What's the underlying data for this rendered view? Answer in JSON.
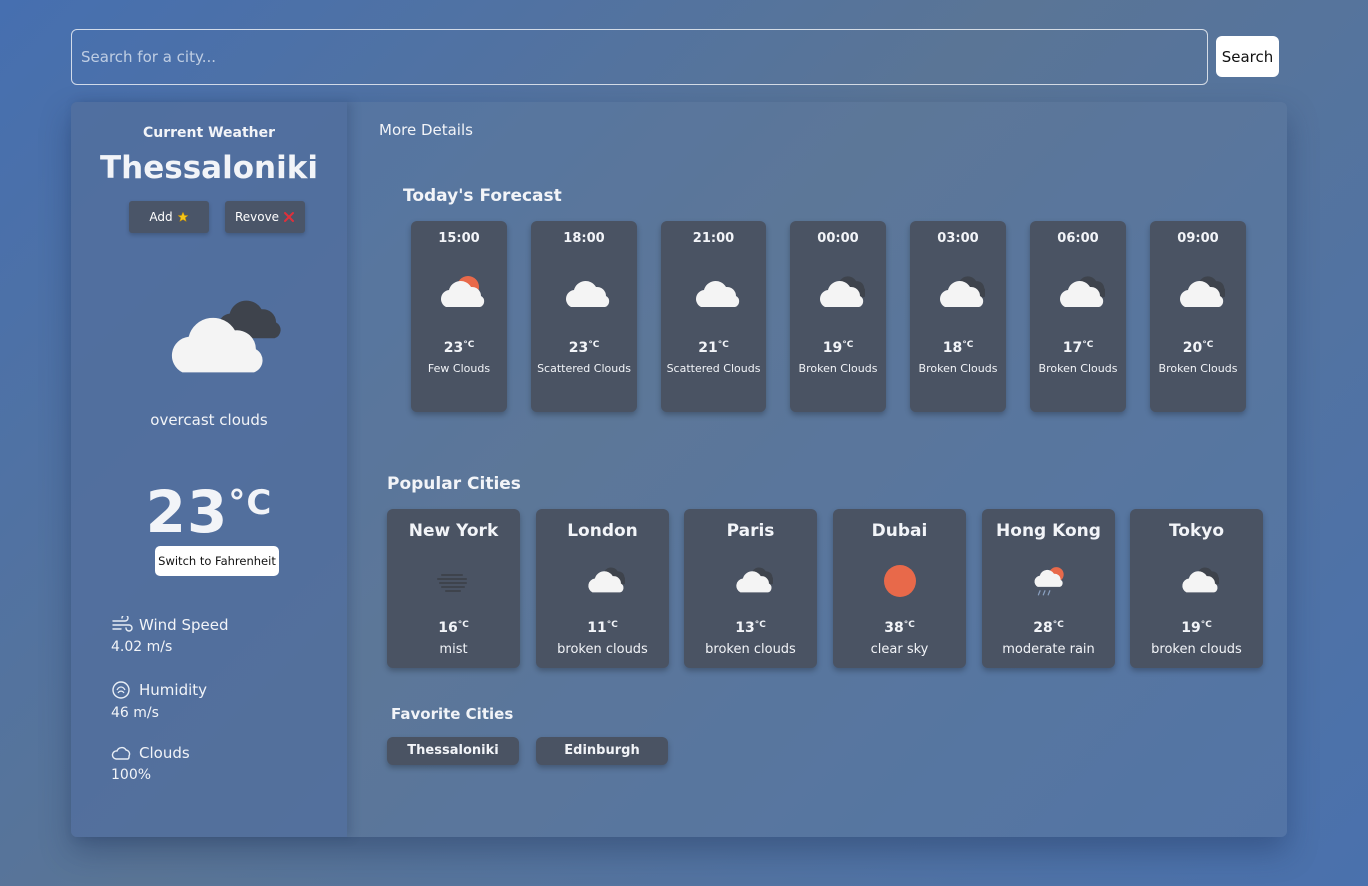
{
  "search": {
    "placeholder": "Search for a city...",
    "button_label": "Search"
  },
  "current": {
    "label": "Current Weather",
    "city": "Thessaloniki",
    "add_label": "Add",
    "remove_label": "Revove",
    "description": "overcast clouds",
    "temperature": "23",
    "unit": "°C",
    "switch_label": "Switch to Fahrenheit",
    "stats": [
      {
        "icon": "wind-icon",
        "label": "Wind Speed",
        "value": "4.02 m/s"
      },
      {
        "icon": "humidity-icon",
        "label": "Humidity",
        "value": "46 m/s"
      },
      {
        "icon": "clouds-icon",
        "label": "Clouds",
        "value": "100%"
      }
    ]
  },
  "details": {
    "more_details": "More Details",
    "forecast_title": "Today's Forecast",
    "forecast": [
      {
        "time": "15:00",
        "temp": "23",
        "unit": "°C",
        "desc": "Few Clouds",
        "icon": "few-clouds-icon"
      },
      {
        "time": "18:00",
        "temp": "23",
        "unit": "°C",
        "desc": "Scattered Clouds",
        "icon": "scattered-clouds-icon"
      },
      {
        "time": "21:00",
        "temp": "21",
        "unit": "°C",
        "desc": "Scattered Clouds",
        "icon": "scattered-clouds-icon"
      },
      {
        "time": "00:00",
        "temp": "19",
        "unit": "°C",
        "desc": "Broken Clouds",
        "icon": "broken-clouds-icon"
      },
      {
        "time": "03:00",
        "temp": "18",
        "unit": "°C",
        "desc": "Broken Clouds",
        "icon": "broken-clouds-icon"
      },
      {
        "time": "06:00",
        "temp": "17",
        "unit": "°C",
        "desc": "Broken Clouds",
        "icon": "broken-clouds-icon"
      },
      {
        "time": "09:00",
        "temp": "20",
        "unit": "°C",
        "desc": "Broken Clouds",
        "icon": "broken-clouds-icon"
      }
    ],
    "popular_title": "Popular Cities",
    "popular": [
      {
        "name": "New York",
        "temp": "16",
        "unit": "°C",
        "desc": "mist",
        "icon": "mist-icon"
      },
      {
        "name": "London",
        "temp": "11",
        "unit": "°C",
        "desc": "broken clouds",
        "icon": "broken-clouds-icon"
      },
      {
        "name": "Paris",
        "temp": "13",
        "unit": "°C",
        "desc": "broken clouds",
        "icon": "broken-clouds-icon"
      },
      {
        "name": "Dubai",
        "temp": "38",
        "unit": "°C",
        "desc": "clear sky",
        "icon": "clear-sky-icon"
      },
      {
        "name": "Hong Kong",
        "temp": "28",
        "unit": "°C",
        "desc": "moderate rain",
        "icon": "rain-icon"
      },
      {
        "name": "Tokyo",
        "temp": "19",
        "unit": "°C",
        "desc": "broken clouds",
        "icon": "broken-clouds-icon"
      }
    ],
    "favorites_title": "Favorite Cities",
    "favorites": [
      "Thessaloniki",
      "Edinburgh"
    ]
  },
  "colors": {
    "card": "#4a5363",
    "sun": "#e8694a",
    "accent_bg": "#5a7596"
  }
}
